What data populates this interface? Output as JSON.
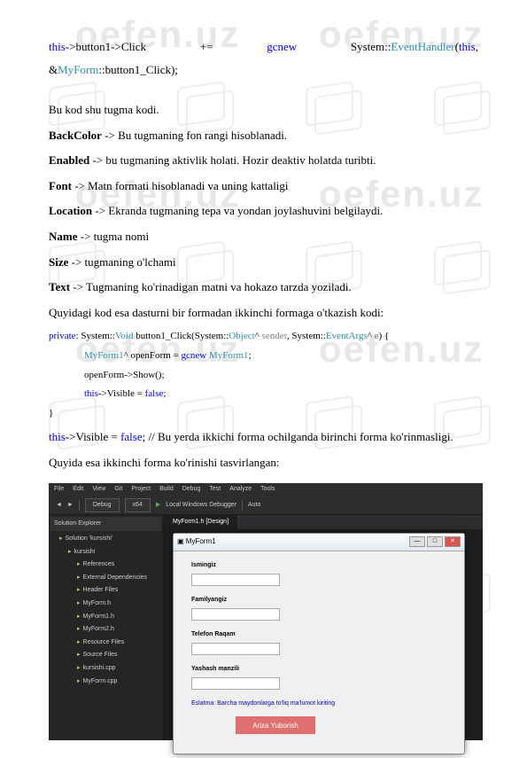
{
  "watermark": "oefen.uz",
  "line1": {
    "p1": "this",
    "p2": "->button1->Click",
    "p3": "+=",
    "p4": "gcnew",
    "p5": "System::",
    "p6": "EventHandler",
    "p7": "(",
    "p8": "this",
    "p9": ","
  },
  "line2": {
    "p1": "&",
    "p2": "MyForm",
    "p3": "::button1_Click);"
  },
  "para1": "Bu kod shu tugma kodi.",
  "prop": {
    "backcolor": {
      "name": "BackColor",
      "desc": " -> Bu tugmaning fon rangi hisoblanadi."
    },
    "enabled": {
      "name": "Enabled",
      "desc": " -> bu tugmaning aktivlik holati. Hozir deaktiv holatda turibti."
    },
    "font": {
      "name": "Font",
      "desc": " -> Matn formati hisoblanadi va uning kattaligi"
    },
    "location": {
      "name": "Location",
      "desc": " -> Ekranda tugmaning tepa va yondan joylashuvini belgilaydi."
    },
    "name": {
      "name": "Name",
      "desc": " -> tugma nomi"
    },
    "size": {
      "name": "Size",
      "desc": " -> tugmaning o'lchami"
    },
    "text": {
      "name": "Text",
      "desc": " -> Tugmaning ko'rinadigan matni va hokazo tarzda yoziladi."
    }
  },
  "para2": "Quyidagi kod esa dasturni bir formadan ikkinchi formaga o'tkazish kodi:",
  "code2": {
    "l1a": "private",
    "l1b": ": System::",
    "l1c": "Void",
    "l1d": " button1_Click(System::",
    "l1e": "Object",
    "l1f": "^ ",
    "l1g": "sender",
    "l1h": ", System::",
    "l1i": "EventArgs",
    "l1j": "^ ",
    "l1k": "e",
    "l1l": ") {",
    "l2a": "MyForm1",
    "l2b": "^ openForm = ",
    "l2c": "gcnew",
    "l2d": " ",
    "l2e": "MyForm1",
    "l2f": ";",
    "l3": "openForm->Show();",
    "l4a": "this",
    "l4b": "->Visible = ",
    "l4c": "false",
    "l4d": ";",
    "l5": "}"
  },
  "line_vis": {
    "p1": "this",
    "p2": "->Visible = ",
    "p3": "false",
    "p4": ";   //  Bu  yerda  ikkichi  forma  ochilganda  birinchi  forma ko'rinmasligi."
  },
  "para3": "Quyida esa ikkinchi forma ko'rinishi tasvirlangan:",
  "vs": {
    "menu": [
      "File",
      "Edit",
      "View",
      "Git",
      "Project",
      "Build",
      "Debug",
      "Test",
      "Analyze",
      "Tools"
    ],
    "config": "Debug",
    "platform": "x64",
    "run": "Local Windows Debugger",
    "auto": "Auto",
    "side_title": "Solution Explorer",
    "tree": [
      {
        "lvl": 1,
        "txt": "Solution 'kursishi'"
      },
      {
        "lvl": 2,
        "txt": "kursishi"
      },
      {
        "lvl": 3,
        "txt": "References"
      },
      {
        "lvl": 3,
        "txt": "External Dependencies"
      },
      {
        "lvl": 3,
        "txt": "Header Files"
      },
      {
        "lvl": 3,
        "txt": "MyForm.h"
      },
      {
        "lvl": 3,
        "txt": "MyForm1.h"
      },
      {
        "lvl": 3,
        "txt": "MyForm2.h"
      },
      {
        "lvl": 3,
        "txt": "Resource Files"
      },
      {
        "lvl": 3,
        "txt": "Source Files"
      },
      {
        "lvl": 3,
        "txt": "kursishi.cpp"
      },
      {
        "lvl": 3,
        "txt": "MyForm.cpp"
      }
    ],
    "tab": "MyForm1.h [Design]"
  },
  "form": {
    "title": "MyForm1",
    "fields": {
      "f1": "Ismingiz",
      "f2": "Familyangiz",
      "f3": "Telefon Raqam",
      "f4": "Yashash manzili"
    },
    "note": "Eslatma: Barcha maydonlarga to'liq ma'lumot kiriting",
    "submit": "Ariza Yuborish"
  }
}
